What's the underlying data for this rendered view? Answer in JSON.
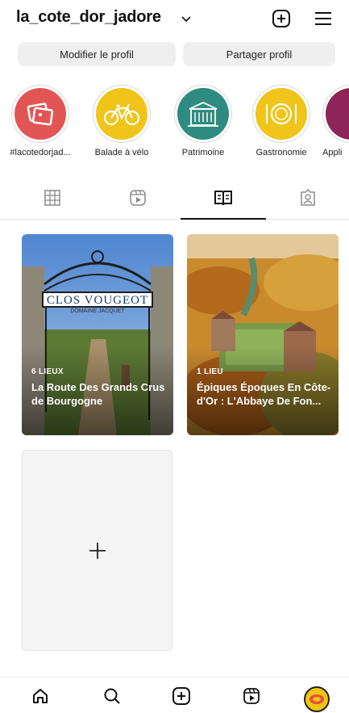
{
  "header": {
    "username": "la_cote_dor_jadore",
    "icons": [
      "chevron-down-icon",
      "plus-square-icon",
      "menu-icon"
    ]
  },
  "profile_buttons": {
    "edit_label": "Modifier le profil",
    "share_label": "Partager profil"
  },
  "highlights": [
    {
      "label": "#lacotedorjad...",
      "color": "#e25555",
      "icon": "photos-icon"
    },
    {
      "label": "Balade à vélo",
      "color": "#f0c419",
      "icon": "bicycle-icon"
    },
    {
      "label": "Patrimoine",
      "color": "#2e8b7f",
      "icon": "chateau-icon"
    },
    {
      "label": "Gastronomie",
      "color": "#f0c419",
      "icon": "plate-icon"
    },
    {
      "label": "Appli",
      "color": "#8e2457",
      "icon": "app-icon"
    }
  ],
  "tabs": {
    "items": [
      "grid-icon",
      "reels-icon",
      "guides-icon",
      "tagged-icon"
    ],
    "active": "guides-icon"
  },
  "guides": [
    {
      "count": "6 LIEUX",
      "title": "La Route Des Grands Crus de Bourgogne",
      "sign_text": "CLOS VOUGEOT",
      "sign_sub": "DOMAINE JACQUET"
    },
    {
      "count": "1 LIEU",
      "title": "Épiques Époques En Côte-d'Or : L'Abbaye De Fon..."
    }
  ],
  "new_guide": {
    "icon": "plus-icon"
  },
  "bottom_nav": [
    "home-icon",
    "search-icon",
    "create-icon",
    "reels-icon",
    "profile-avatar"
  ],
  "colors": {
    "accent": "#111111",
    "button_bg": "#efefef",
    "avatar_bg": "#f1c40f"
  }
}
